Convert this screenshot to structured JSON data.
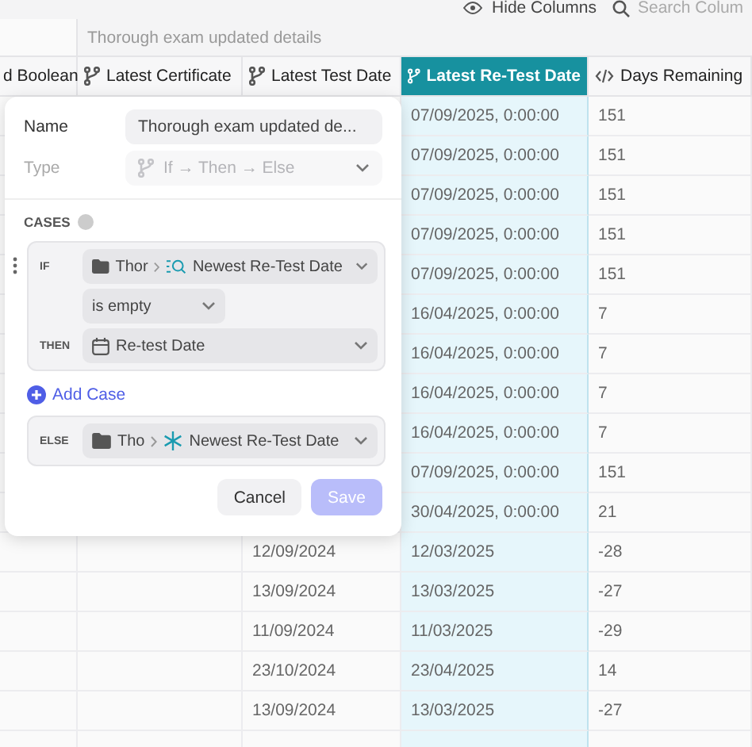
{
  "toolbar": {
    "hide_columns": "Hide Columns",
    "search": {
      "placeholder": "Search Colum"
    }
  },
  "group_header": "Thorough exam updated details",
  "columns": [
    {
      "label": "d Boolean",
      "kind": "plain",
      "selected": false
    },
    {
      "label": "Latest Certificate",
      "kind": "branch",
      "selected": false
    },
    {
      "label": "Latest Test Date",
      "kind": "branch",
      "selected": false
    },
    {
      "label": "Latest Re-Test Date",
      "kind": "branch",
      "selected": true
    },
    {
      "label": "Days Remaining",
      "kind": "code",
      "selected": false
    }
  ],
  "rows": [
    {
      "retest_date": "07/09/2025, 0:00:00",
      "days": "151"
    },
    {
      "retest_date": "07/09/2025, 0:00:00",
      "days": "151"
    },
    {
      "retest_date": "07/09/2025, 0:00:00",
      "days": "151"
    },
    {
      "retest_date": "07/09/2025, 0:00:00",
      "days": "151"
    },
    {
      "retest_date": "07/09/2025, 0:00:00",
      "days": "151"
    },
    {
      "retest_date": "16/04/2025, 0:00:00",
      "days": "7"
    },
    {
      "retest_date": "16/04/2025, 0:00:00",
      "days": "7"
    },
    {
      "retest_date": "16/04/2025, 0:00:00",
      "days": "7"
    },
    {
      "retest_date": "16/04/2025, 0:00:00",
      "days": "7"
    },
    {
      "retest_date": "07/09/2025, 0:00:00",
      "days": "151"
    },
    {
      "retest_date": "30/04/2025, 0:00:00",
      "days": "21"
    },
    {
      "test_date": "12/09/2024",
      "retest_date": "12/03/2025",
      "days": "-28"
    },
    {
      "test_date": "13/09/2024",
      "retest_date": "13/03/2025",
      "days": "-27"
    },
    {
      "test_date": "11/09/2024",
      "retest_date": "11/03/2025",
      "days": "-29"
    },
    {
      "test_date": "23/10/2024",
      "retest_date": "23/04/2025",
      "days": "14"
    },
    {
      "test_date": "13/09/2024",
      "retest_date": "13/03/2025",
      "days": "-27"
    }
  ],
  "popup": {
    "name_label": "Name",
    "name_value": "Thorough exam updated de...",
    "type_label": "Type",
    "type_value": "If → Then → Else",
    "type_disabled": true,
    "cases_label": "CASES",
    "cases": [
      {
        "if_label": "IF",
        "folder": "Thor",
        "field": "Newest Re-Test Date",
        "kind": "lookup",
        "operator": "is empty",
        "then_label": "THEN",
        "then_value": "Re-test Date"
      }
    ],
    "add_case": "Add Case",
    "else": {
      "label": "ELSE",
      "folder": "Tho",
      "field": "Newest Re-Test Date",
      "kind": "formula"
    },
    "cancel": "Cancel",
    "save": "Save",
    "save_disabled": true
  }
}
